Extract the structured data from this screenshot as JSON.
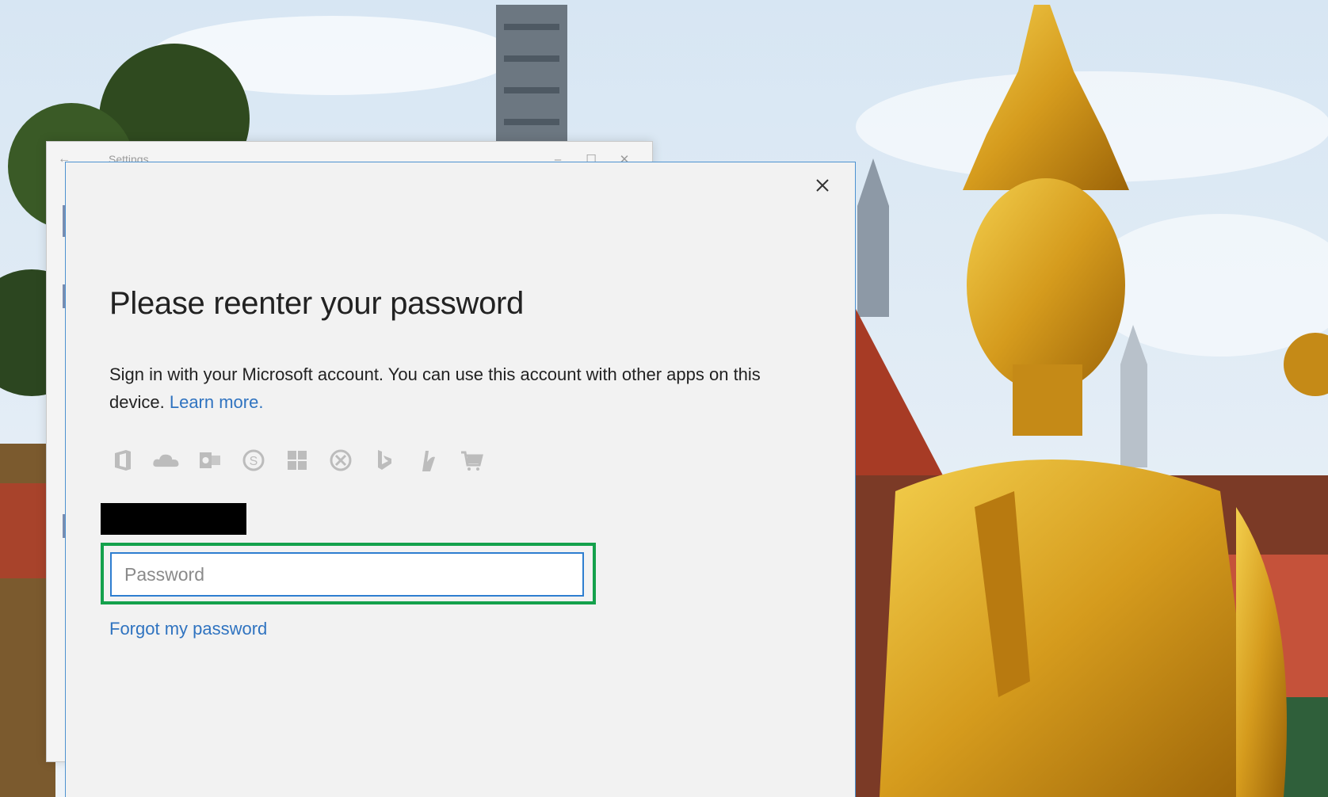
{
  "settings_window": {
    "title": "Settings",
    "back_glyph": "←",
    "minimize_glyph": "–",
    "maximize_glyph": "☐",
    "close_glyph": "✕"
  },
  "dialog": {
    "title": "Please reenter your password",
    "description": "Sign in with your Microsoft account. You can use this account with other apps on this device.",
    "learn_more_label": "Learn more.",
    "app_icons": [
      "office-icon",
      "onedrive-icon",
      "outlook-icon",
      "skype-icon",
      "windows-icon",
      "xbox-icon",
      "bing-icon",
      "msn-icon",
      "store-icon"
    ],
    "password": {
      "placeholder": "Password",
      "value": ""
    },
    "forgot_password_label": "Forgot my password"
  },
  "colors": {
    "accent": "#2f73c0",
    "input_border": "#2e7ed0",
    "highlight_box": "#14a14c",
    "dialog_bg": "#f2f2f2"
  }
}
